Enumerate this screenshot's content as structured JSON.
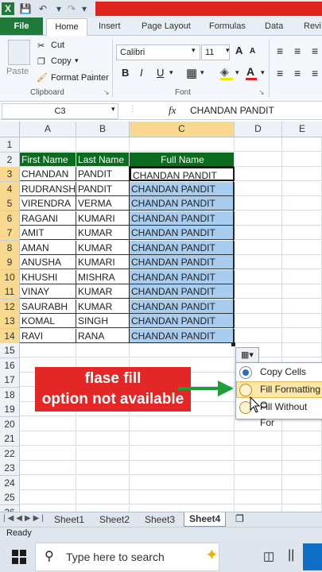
{
  "quick_access": {
    "icon": "excel-icon"
  },
  "ribbon": {
    "tabs": [
      "File",
      "Home",
      "Insert",
      "Page Layout",
      "Formulas",
      "Data",
      "Revi"
    ],
    "clipboard": {
      "paste": "Paste",
      "cut": "Cut",
      "copy": "Copy",
      "format_painter": "Format Painter",
      "label": "Clipboard"
    },
    "font": {
      "family": "Calibri",
      "size": "11",
      "bold": "B",
      "italic": "I",
      "underline": "U",
      "label": "Font",
      "font_color_letter": "A"
    }
  },
  "formula_bar": {
    "name_box": "C3",
    "fx": "fx",
    "value": "CHANDAN PANDIT"
  },
  "columns": [
    "A",
    "B",
    "C",
    "D",
    "E"
  ],
  "rows": [
    "1",
    "2",
    "3",
    "4",
    "5",
    "6",
    "7",
    "8",
    "9",
    "10",
    "11",
    "12",
    "13",
    "14",
    "15",
    "16",
    "17",
    "18",
    "19",
    "20",
    "21",
    "22",
    "23",
    "24",
    "25",
    "26"
  ],
  "headers": {
    "first": "First Name",
    "last": "Last Name",
    "full": "Full Name"
  },
  "table": [
    {
      "first": "CHANDAN",
      "last": "PANDIT",
      "full": "CHANDAN PANDIT"
    },
    {
      "first": "RUDRANSH",
      "last": "PANDIT",
      "full": "CHANDAN PANDIT"
    },
    {
      "first": "VIRENDRA",
      "last": "VERMA",
      "full": "CHANDAN PANDIT"
    },
    {
      "first": "RAGANI",
      "last": "KUMARI",
      "full": "CHANDAN PANDIT"
    },
    {
      "first": "AMIT",
      "last": "KUMAR",
      "full": "CHANDAN PANDIT"
    },
    {
      "first": "AMAN",
      "last": "KUMAR",
      "full": "CHANDAN PANDIT"
    },
    {
      "first": "ANUSHA",
      "last": "KUMARI",
      "full": "CHANDAN PANDIT"
    },
    {
      "first": "KHUSHI",
      "last": "MISHRA",
      "full": "CHANDAN PANDIT"
    },
    {
      "first": "VINAY",
      "last": "KUMAR",
      "full": "CHANDAN PANDIT"
    },
    {
      "first": "SAURABH",
      "last": "KUMAR",
      "full": "CHANDAN PANDIT"
    },
    {
      "first": "KOMAL",
      "last": "SINGH",
      "full": "CHANDAN PANDIT"
    },
    {
      "first": "RAVI",
      "last": "RANA",
      "full": "CHANDAN PANDIT"
    }
  ],
  "callout": {
    "line1": "flase fill",
    "line2": "option not available"
  },
  "autofill_menu": {
    "copy_cells": "Copy Cells",
    "fill_formatting": "Fill Formatting O",
    "fill_without": "Fill Without For"
  },
  "sheets": [
    "Sheet1",
    "Sheet2",
    "Sheet3",
    "Sheet4"
  ],
  "active_sheet": "Sheet4",
  "status": "Ready",
  "taskbar": {
    "search_placeholder": "Type here to search"
  },
  "colors": {
    "header_green": "#0b6b1f",
    "fill_blue": "#a8cdef",
    "callout_red": "#e32626",
    "arrow_green": "#1e9e3a"
  }
}
